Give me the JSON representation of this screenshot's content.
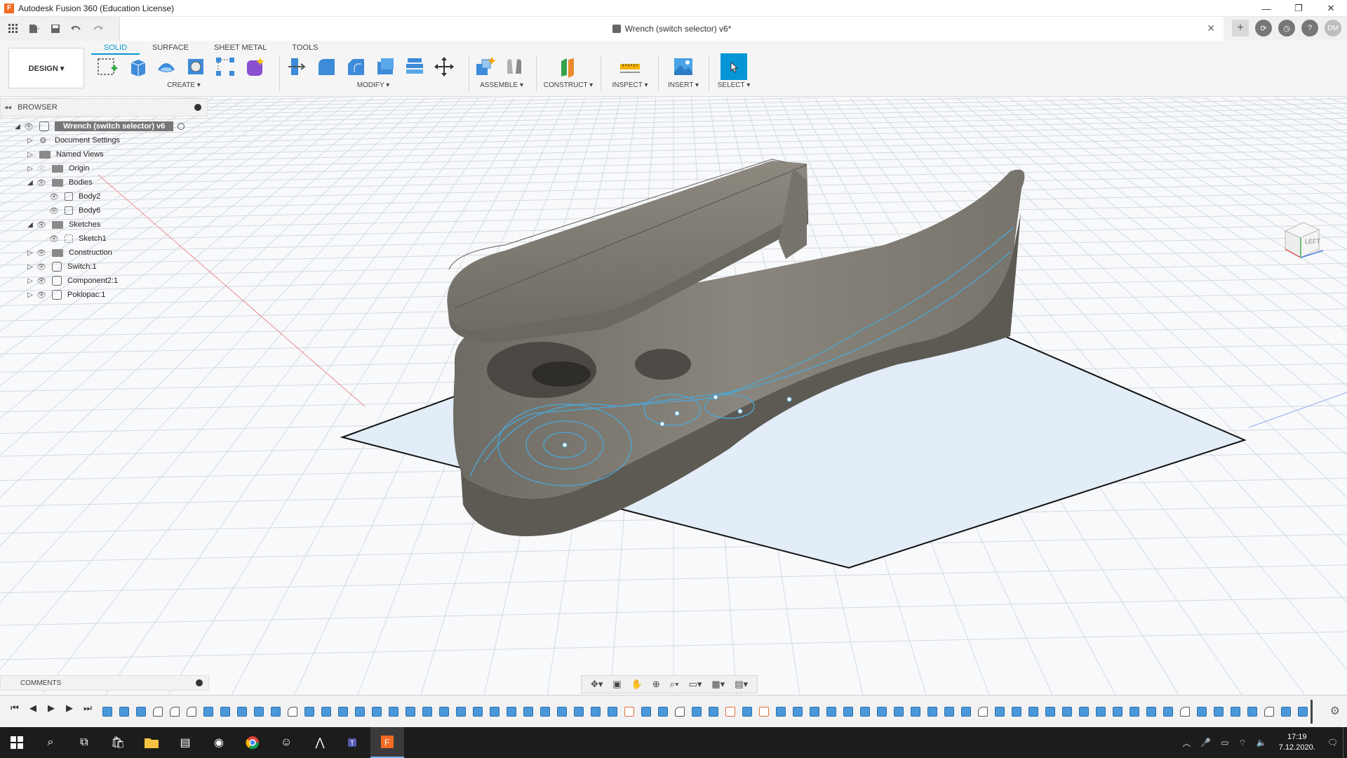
{
  "window": {
    "title": "Autodesk Fusion 360 (Education License)",
    "app_logo": "F",
    "controls": [
      "—",
      "❐",
      "✕"
    ]
  },
  "quick_access": {
    "icons": [
      "grid-icon",
      "file-icon",
      "save-icon",
      "undo-icon",
      "redo-icon"
    ]
  },
  "document_tab": {
    "title": "Wrench (switch selector) v6*",
    "close": "✕"
  },
  "header_right": {
    "add": "+",
    "avatar": "DM"
  },
  "ribbon": {
    "workspace": "DESIGN ▾",
    "tabs": [
      "SOLID",
      "SURFACE",
      "SHEET METAL",
      "TOOLS"
    ],
    "active_tab": "SOLID",
    "groups": {
      "create": "CREATE ▾",
      "modify": "MODIFY ▾",
      "assemble": "ASSEMBLE ▾",
      "construct": "CONSTRUCT ▾",
      "inspect": "INSPECT ▾",
      "insert": "INSERT ▾",
      "select": "SELECT ▾"
    },
    "accent": "#0696d7"
  },
  "browser": {
    "title": "BROWSER",
    "root": "Wrench (switch selector) v6",
    "items": [
      {
        "label": "Document Settings"
      },
      {
        "label": "Named Views"
      },
      {
        "label": "Origin"
      },
      {
        "label": "Bodies"
      },
      {
        "label": "Body2"
      },
      {
        "label": "Body6"
      },
      {
        "label": "Sketches"
      },
      {
        "label": "Sketch1"
      },
      {
        "label": "Construction"
      },
      {
        "label": "Switch:1"
      },
      {
        "label": "Component2:1"
      },
      {
        "label": "Poklopac:1"
      }
    ]
  },
  "comments": {
    "title": "COMMENTS"
  },
  "viewcube": {
    "face_label": "LEFT"
  },
  "taskbar": {
    "time": "17:19",
    "date": "7.12.2020."
  }
}
